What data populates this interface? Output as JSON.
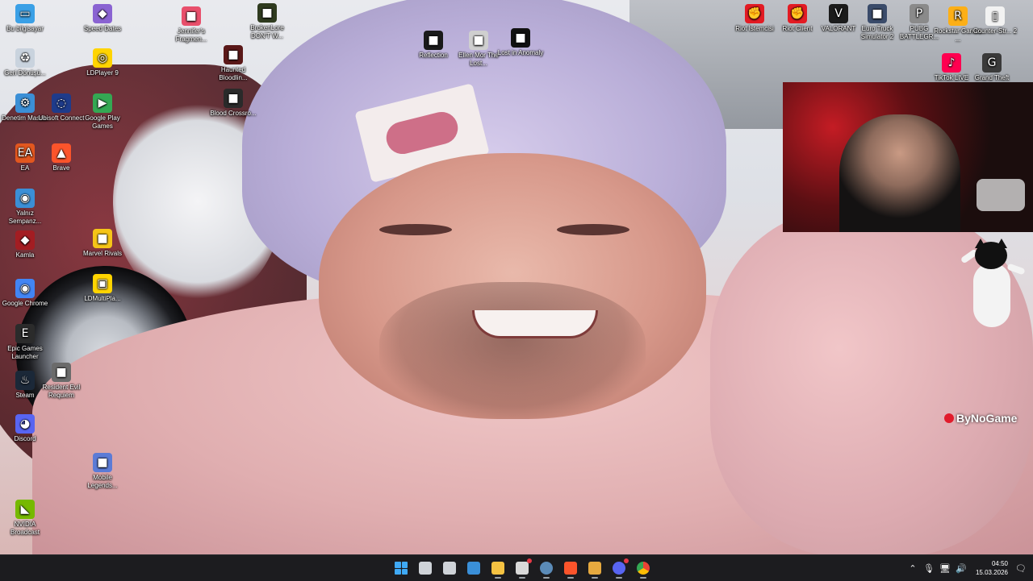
{
  "desktop": {
    "icons": [
      {
        "label": "Bu bilgisayar",
        "icon": "computer-icon",
        "color": "#3aa0e6"
      },
      {
        "label": "Geri Dönüşü...",
        "icon": "recycle-bin-icon",
        "color": "#c9d3de"
      },
      {
        "label": "Denetim Masası",
        "icon": "control-panel-icon",
        "color": "#3b8fd6"
      },
      {
        "label": "EA",
        "icon": "ea-icon",
        "color": "#e2571f"
      },
      {
        "label": "Yalnız Sempanz...",
        "icon": "chrome-icon",
        "color": "#3b8fd6"
      },
      {
        "label": "Kamla",
        "icon": "app-icon",
        "color": "#a31d22"
      },
      {
        "label": "Google Chrome",
        "icon": "chrome-icon",
        "color": "#4285f4"
      },
      {
        "label": "Epic Games Launcher",
        "icon": "epic-games-icon",
        "color": "#2b2b2b"
      },
      {
        "label": "Steam",
        "icon": "steam-icon",
        "color": "#1b2838"
      },
      {
        "label": "Discord",
        "icon": "discord-icon",
        "color": "#5865f2"
      },
      {
        "label": "NVIDIA Broadcast",
        "icon": "nvidia-icon",
        "color": "#76b900"
      },
      {
        "label": "Speed Dates",
        "icon": "app-icon",
        "color": "#8a63d2"
      },
      {
        "label": "LDPlayer 9",
        "icon": "ldplayer-icon",
        "color": "#ffd400"
      },
      {
        "label": "Ubisoft Connect",
        "icon": "ubisoft-icon",
        "color": "#1e3b8a"
      },
      {
        "label": "Brave",
        "icon": "brave-icon",
        "color": "#fb542b"
      },
      {
        "label": "Google Play Games",
        "icon": "play-games-icon",
        "color": "#34a853"
      },
      {
        "label": "Marvel Rivals",
        "icon": "game-icon",
        "color": "#f5c518"
      },
      {
        "label": "LDMultiPla...",
        "icon": "ldmultiplayer-icon",
        "color": "#ffd400"
      },
      {
        "label": "Resident Evil Requiem",
        "icon": "game-icon",
        "color": "#6b6b6b"
      },
      {
        "label": "Mobile Legends...",
        "icon": "game-icon",
        "color": "#5b7bd6"
      },
      {
        "label": "Jennifer's Fragmen...",
        "icon": "game-icon",
        "color": "#e84f6b"
      },
      {
        "label": "Haunted Bloodlin...",
        "icon": "game-icon",
        "color": "#5a1818"
      },
      {
        "label": "Blood Crossro...",
        "icon": "game-icon",
        "color": "#2a2a2a"
      },
      {
        "label": "BrokenLore DON'T W...",
        "icon": "game-icon",
        "color": "#2f3b1f"
      },
      {
        "label": "Reflection",
        "icon": "game-icon",
        "color": "#1a1a1a"
      },
      {
        "label": "Ellen Mor The Lost...",
        "icon": "game-icon",
        "color": "#cfcfcf"
      },
      {
        "label": "Lost in Anomaly",
        "icon": "game-icon",
        "color": "#111111"
      },
      {
        "label": "Riot İstemcisi",
        "icon": "riot-icon",
        "color": "#e31b23"
      },
      {
        "label": "Riot Client",
        "icon": "riot-icon",
        "color": "#e31b23"
      },
      {
        "label": "VALORANT",
        "icon": "valorant-icon",
        "color": "#1b1b1b"
      },
      {
        "label": "Euro Truck Simulator 2",
        "icon": "game-icon",
        "color": "#3a4b6a"
      },
      {
        "label": "PUBG BATTLEGR...",
        "icon": "pubg-icon",
        "color": "#8a8a8a"
      },
      {
        "label": "Rockstar Games ...",
        "icon": "rockstar-icon",
        "color": "#fcaf17"
      },
      {
        "label": "Counter-Str... 2",
        "icon": "file-icon",
        "color": "#f2f2f2"
      },
      {
        "label": "TikTok LIVE",
        "icon": "tiktok-icon",
        "color": "#ff0050"
      },
      {
        "label": "Grand Theft",
        "icon": "gta-icon",
        "color": "#3a3a3a"
      }
    ]
  },
  "overlay": {
    "watermark": "ByNoGame"
  },
  "taskbar": {
    "apps": [
      {
        "name": "start-button",
        "color": "#3fa9f5"
      },
      {
        "name": "task-view-button",
        "color": "#cfd3d8"
      },
      {
        "name": "app-button",
        "color": "#cfd3d8"
      },
      {
        "name": "photos-button",
        "color": "#3a8fd8"
      },
      {
        "name": "file-explorer-button",
        "color": "#f5c242"
      },
      {
        "name": "app-button",
        "color": "#d9d9d9"
      },
      {
        "name": "steam-button",
        "color": "#5b8bb8"
      },
      {
        "name": "brave-button",
        "color": "#fb542b"
      },
      {
        "name": "app-button",
        "color": "#e6a93f"
      },
      {
        "name": "discord-button",
        "color": "#5865f2"
      },
      {
        "name": "chrome-button",
        "color": "#4285f4"
      }
    ],
    "clock": {
      "time": "04:50",
      "date": "15.03.2026"
    }
  }
}
